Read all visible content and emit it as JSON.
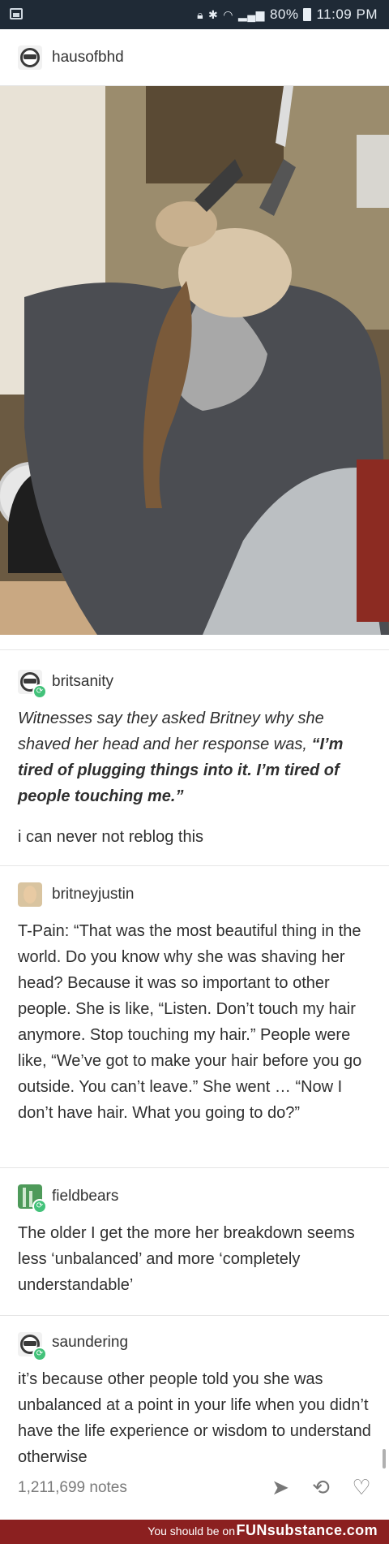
{
  "status_bar": {
    "battery": "80%",
    "time": "11:09 PM",
    "icons": [
      "image-icon",
      "lock-icon",
      "bluetooth-icon",
      "wifi-icon",
      "signal-icon",
      "battery-icon"
    ]
  },
  "post": {
    "author": "hausofbhd",
    "notes": "1,211,699 notes"
  },
  "reblogs": [
    {
      "user": "britsanity",
      "quote_italic": "Witnesses say they asked Britney why she shaved her head and her response was, ",
      "quote_bold": "“I’m tired of plugging things into it. I’m tired of people touching me.”",
      "comment": "i can never not reblog this"
    },
    {
      "user": "britneyjustin",
      "text": "T-Pain: “That was the most beautiful thing in the world. Do you know why she was shaving her head? Because it was so important to other people. She is like, “Listen. Don’t touch my hair anymore. Stop touching my hair.” People were like, “We’ve got to make your hair before you go outside. You can’t leave.” She went … “Now I don’t have hair. What you going to do?”"
    },
    {
      "user": "fieldbears",
      "text": "The older I get the more her breakdown seems less ‘unbalanced’ and more ‘completely understandable’"
    },
    {
      "user": "saundering",
      "text": "it’s because other people told you she was unbalanced at a point in your life when you didn’t have the life experience or wisdom to understand otherwise"
    }
  ],
  "ad_bar": {
    "prefix": "You should be on",
    "brand": "FUNsubstance.com"
  },
  "colors": {
    "status_bg": "#1f2a36",
    "reblog_green": "#43c27a",
    "ad_bg": "#8b2020"
  }
}
